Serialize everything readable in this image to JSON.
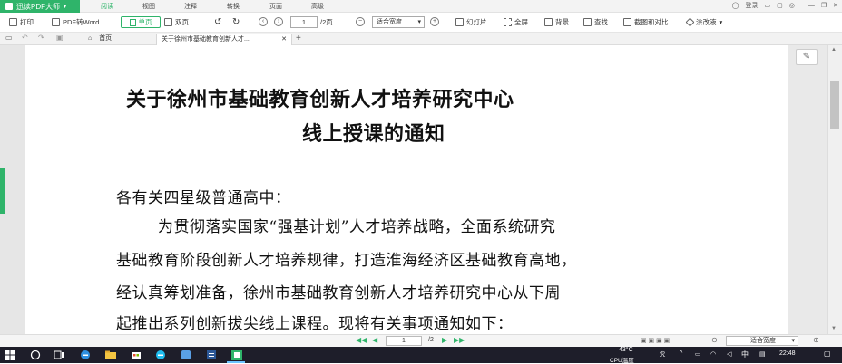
{
  "app": {
    "name": "迅读PDF大师",
    "menus": [
      "阅读",
      "视图",
      "注释",
      "转换",
      "页面",
      "高级"
    ],
    "active_menu": "阅读",
    "right_items": [
      "登录"
    ]
  },
  "toolbar": {
    "print": "打印",
    "pdf_to_word": "PDF转Word",
    "single_page": "单页",
    "double_page": "双页",
    "page_current": "1",
    "page_total": "/2页",
    "zoom": "适合宽度",
    "slideshow": "幻灯片",
    "fullscreen": "全屏",
    "background": "背景",
    "find": "查找",
    "screenshot": "截图和对比",
    "eraser": "涂改液"
  },
  "tabs": {
    "home": "首页",
    "doc": "关于徐州市基础教育创新人才..."
  },
  "document": {
    "title_line1": "关于徐州市基础教育创新人才培养研究中心",
    "title_line2": "线上授课的通知",
    "salutation": "各有关四星级普通高中：",
    "body": [
      "为贯彻落实国家“强基计划”人才培养战略，全面系统研究",
      "基础教育阶段创新人才培养规律，打造淮海经济区基础教育高地，",
      "经认真筹划准备，徐州市基础教育创新人才培养研究中心从下周",
      "起推出系列创新拔尖线上课程。现将有关事项通知如下："
    ]
  },
  "statusbar": {
    "page_current": "1",
    "page_total": "/2",
    "zoom": "适合宽度"
  },
  "taskbar": {
    "temperature": "43°C",
    "temperature_label": "CPU温度",
    "ime": "中",
    "time": "22:48"
  }
}
